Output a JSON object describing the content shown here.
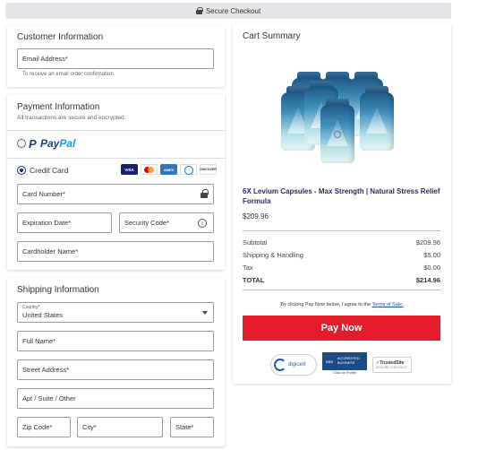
{
  "topbar": {
    "label": "Secure Checkout"
  },
  "customer": {
    "title": "Customer Information",
    "email_placeholder": "Email Address*",
    "email_note": "To receive an email order confirmation."
  },
  "payment": {
    "title": "Payment Information",
    "subtitle": "All transactions are secure and encrypted.",
    "paypal": {
      "pay": "Pay",
      "pal": "Pal"
    },
    "credit_card_label": "Credit Card",
    "card_logos": [
      "VISA",
      "mastercard",
      "AMEX",
      "diners",
      "DISCOVER"
    ],
    "card_number_placeholder": "Card Number*",
    "expiration_placeholder": "Expiration Date*",
    "security_code_placeholder": "Security Code*",
    "cardholder_placeholder": "Cardholder Name*"
  },
  "shipping": {
    "title": "Shipping Information",
    "country_label": "Country*",
    "country_value": "United States",
    "full_name_placeholder": "Full Name*",
    "street_placeholder": "Street Address*",
    "apt_placeholder": "Apt / Suite / Other",
    "zip_placeholder": "Zip Code*",
    "city_placeholder": "City*",
    "state_placeholder": "State*"
  },
  "cart": {
    "title": "Cart Summary",
    "product_title": "6X Levium Capsules - Max Strength | Natural Stress Relief Formula",
    "product_price": "$209.96",
    "lines": [
      {
        "label": "Subtotal",
        "value": "$209.96"
      },
      {
        "label": "Shipping & Handling",
        "value": "$5.00"
      },
      {
        "label": "Tax",
        "value": "$0.00"
      }
    ],
    "total": {
      "label": "TOTAL",
      "value": "$214.96"
    },
    "terms_prefix": "By clicking Pay Now below, I agree to the",
    "terms_link": "Terms of Sale.",
    "pay_button": "Pay Now",
    "badges": {
      "digicert": "digicert",
      "bbb_seal": "BBB",
      "bbb_line1": "ACCREDITED",
      "bbb_line2": "BUSINESS",
      "bbb_click": "Click for Profile",
      "trustedsite_a": "Trusted",
      "trustedsite_b": "Site",
      "trustedsite_sub": "SECURE CHECKOUT"
    }
  },
  "colors": {
    "pay_button": "#e31b2a",
    "product_title": "#2a2d5c",
    "paypal_dark": "#253b80",
    "paypal_light": "#179bd7"
  }
}
